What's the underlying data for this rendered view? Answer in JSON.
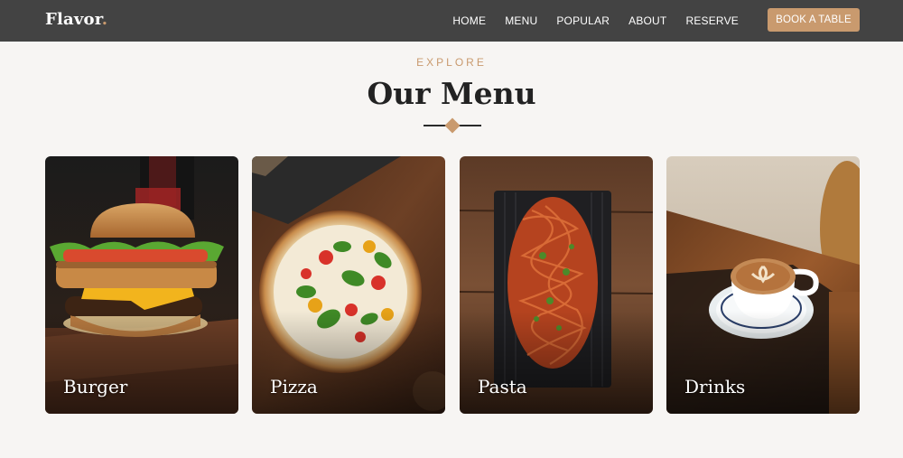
{
  "brand": {
    "name": "Flavor",
    "dot": "."
  },
  "nav": {
    "links": [
      "HOME",
      "MENU",
      "POPULAR",
      "ABOUT",
      "RESERVE"
    ],
    "cta": "BOOK A TABLE"
  },
  "section": {
    "eyebrow": "EXPLORE",
    "title": "Our Menu"
  },
  "menu": {
    "items": [
      {
        "label": "Burger",
        "image": "burger-image"
      },
      {
        "label": "Pizza",
        "image": "pizza-image"
      },
      {
        "label": "Pasta",
        "image": "pasta-image"
      },
      {
        "label": "Drinks",
        "image": "coffee-image"
      }
    ]
  },
  "colors": {
    "nav_bg": "#434343",
    "accent": "#c99a6e",
    "page_bg": "#f7f5f3",
    "title": "#222222"
  }
}
